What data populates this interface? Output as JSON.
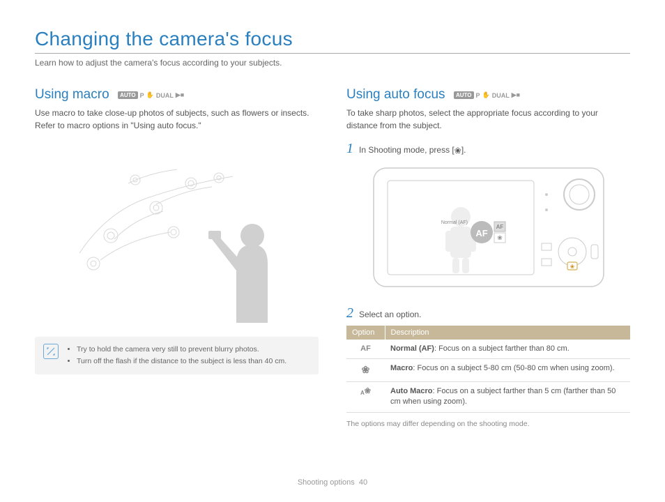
{
  "page_title": "Changing the camera's focus",
  "page_subtitle": "Learn how to adjust the camera's focus according to your subjects.",
  "mode_labels": {
    "auto": "AUTO",
    "p": "P",
    "dual": "DUAL"
  },
  "left": {
    "heading": "Using macro",
    "intro": "Use macro to take close-up photos of subjects, such as flowers or insects. Refer to macro options in \"Using auto focus.\"",
    "tips": [
      "Try to hold the camera very still to prevent blurry photos.",
      "Turn off the flash if the distance to the subject is less than 40 cm."
    ]
  },
  "right": {
    "heading": "Using auto focus",
    "intro": "To take sharp photos, select the appropriate focus according to your distance from the subject.",
    "step1_prefix": "In Shooting mode, press [",
    "step1_suffix": "].",
    "camera_screen_label": "Normal (AF)",
    "camera_af_badge": "AF",
    "step2": "Select an option.",
    "table": {
      "head_option": "Option",
      "head_desc": "Description",
      "rows": [
        {
          "icon": "AF",
          "bold": "Normal (AF)",
          "rest": ": Focus on a subject farther than 80 cm."
        },
        {
          "icon": "❀",
          "bold": "Macro",
          "rest": ": Focus on a subject 5-80 cm (50-80 cm when using zoom)."
        },
        {
          "icon": "A❀",
          "bold": "Auto Macro",
          "rest": ": Focus on a subject farther than 5 cm (farther than 50 cm when using zoom)."
        }
      ]
    },
    "table_note": "The options may differ depending on the shooting mode."
  },
  "footer": {
    "section": "Shooting options",
    "page": "40"
  }
}
